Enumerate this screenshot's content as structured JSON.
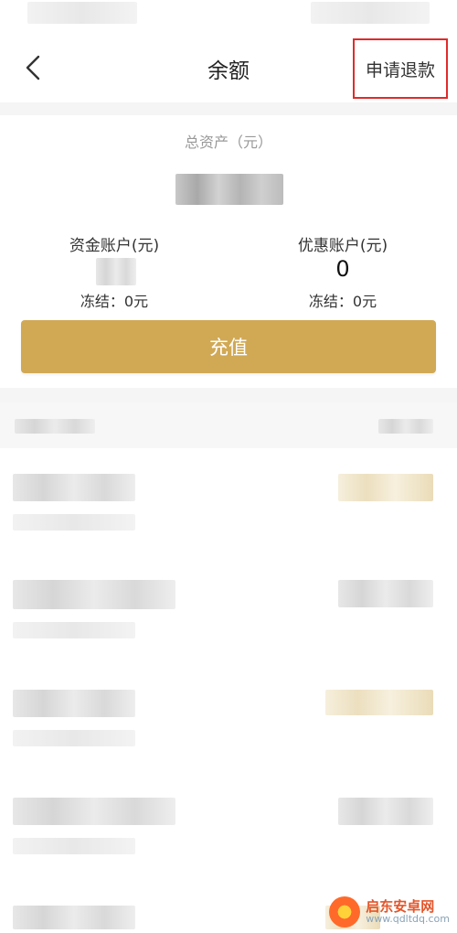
{
  "header": {
    "title": "余额",
    "refund_label": "申请退款"
  },
  "summary": {
    "total_assets_label": "总资产（元）"
  },
  "accounts": [
    {
      "label": "资金账户(元)",
      "value": "",
      "frozen": "冻结：0元"
    },
    {
      "label": "优惠账户(元)",
      "value": "0",
      "frozen": "冻结：0元"
    }
  ],
  "recharge_label": "充值",
  "icons": {
    "back": "chevron-left-icon"
  },
  "colors": {
    "accent_gold": "#d1a955",
    "highlight_red": "#e02b2b"
  },
  "watermark": {
    "name": "启东安卓网",
    "url": "www.qdltdq.com"
  }
}
